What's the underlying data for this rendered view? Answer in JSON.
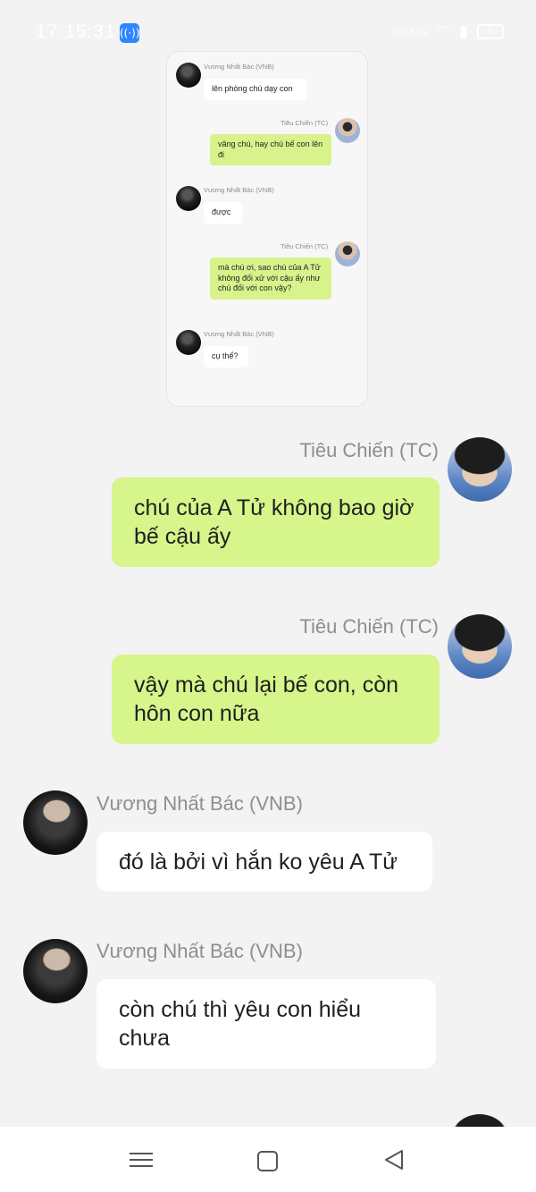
{
  "status_bar": {
    "time": "17:15:31",
    "app_icon": "broadcast-icon",
    "speed": "36.0 KB/s",
    "battery": "31"
  },
  "inner_screenshot": {
    "messages": [
      {
        "sender": "Vương Nhất Bác (VNB)",
        "text": "lên phòng chú dạy con"
      },
      {
        "sender": "Tiêu Chiến (TC)",
        "text": "vâng chú, hay chú bế con lên đi"
      },
      {
        "sender": "Vương Nhất Bác (VNB)",
        "text": "được"
      },
      {
        "sender": "Tiêu Chiến (TC)",
        "text": "mà chú ơi, sao chú của A Tử không đối xử với cậu ấy như chú đối với con vậy?"
      },
      {
        "sender": "Vương Nhất Bác (VNB)",
        "text": "cụ thể?"
      }
    ]
  },
  "messages": [
    {
      "sender": "Tiêu Chiến (TC)",
      "text": "chú của A Tử không bao giờ bế cậu ấy"
    },
    {
      "sender": "Tiêu Chiến (TC)",
      "text": "vậy mà chú lại bế con, còn hôn con nữa"
    },
    {
      "sender": "Vương Nhất Bác (VNB)",
      "text": "đó là bởi vì hắn ko yêu A Tử"
    },
    {
      "sender": "Vương Nhất Bác (VNB)",
      "text": "còn chú thì yêu con hiểu chưa"
    },
    {
      "sender": "Tiêu Chiến (TC)",
      "text": ""
    }
  ],
  "colors": {
    "sent_bubble": "#d6f58a",
    "received_bubble": "#ffffff",
    "background": "#f3f3f3"
  },
  "nav_bar": {
    "icons": [
      "menu-icon",
      "home-icon",
      "back-icon"
    ]
  }
}
